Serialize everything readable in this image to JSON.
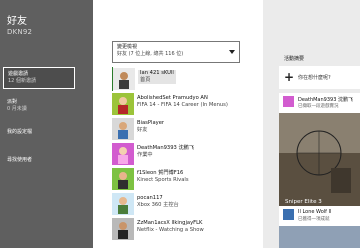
{
  "sidebar": {
    "title": "好友",
    "gamertag": "DKN92",
    "items": [
      {
        "label": "遊戲邀請",
        "sub": "12 個新邀請"
      },
      {
        "label": "派對",
        "sub": "0 月未讀"
      },
      {
        "label": "我的設定檔",
        "sub": ""
      },
      {
        "label": "尋找使用者",
        "sub": ""
      }
    ]
  },
  "filter": {
    "label": "變更檢視",
    "value": "好友 (7 位上線, 總共 116 位)"
  },
  "friends": [
    {
      "name": "Ian 421 sKUll",
      "status": "首頁"
    },
    {
      "name": "AbolishedSet Pramudyo AN",
      "status": "FIFA 14 - FIFA 14 Career (In Menus)"
    },
    {
      "name": "BiasPlayer",
      "status": "好友"
    },
    {
      "name": "DeathMan9393 沈鹏飞",
      "status": "作業中"
    },
    {
      "name": "f1Sleon 賀門博F16",
      "status": "Kinect Sports Rivals"
    },
    {
      "name": "pocan117",
      "status": "Xbox 360 主控台"
    },
    {
      "name": "ZzMan1acsX lIkingjayFLK",
      "status": "Netflix - Watching a Show"
    }
  ],
  "feed": {
    "title": "活動摘要",
    "post_prompt": "你在想什麼呢?",
    "cards": [
      {
        "name": "DeathMan9393 沈鹏飞",
        "sub": "已擷取一段遊戲實況",
        "caption": "Sniper Elite 3"
      },
      {
        "name": "Il Lone Wolf Il",
        "sub": "已獲得一項成就"
      }
    ]
  },
  "colors": {
    "sidebar_bg": "#5f5f5f",
    "feed_bg": "#ebebeb",
    "highlight": "#2b7a2b"
  }
}
